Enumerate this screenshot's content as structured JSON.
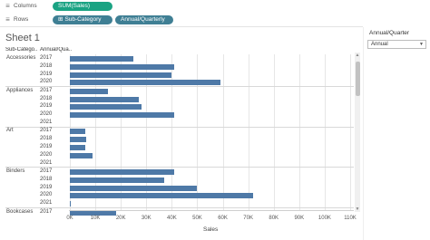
{
  "shelves": {
    "columns": {
      "label": "Columns",
      "icon": "columns-icon",
      "pills": [
        {
          "text": "SUM(Sales)",
          "color": "#1aa383"
        }
      ]
    },
    "rows": {
      "label": "Rows",
      "icon": "rows-icon",
      "pills": [
        {
          "text": "Sub-Category",
          "color": "#3f7f94"
        },
        {
          "text": "Annual/Quarterly",
          "color": "#3f7f94"
        }
      ]
    }
  },
  "sheet": {
    "title": "Sheet 1",
    "header_subcategory": "Sub-Catego..",
    "header_year": "Annual/Qua.."
  },
  "chart_data": {
    "type": "bar",
    "orientation": "horizontal",
    "xlabel": "Sales",
    "xlim": [
      0,
      110000
    ],
    "x_ticks": [
      "0K",
      "10K",
      "20K",
      "30K",
      "40K",
      "50K",
      "60K",
      "70K",
      "80K",
      "90K",
      "100K",
      "110K"
    ],
    "groups": [
      {
        "category": "Accessories",
        "rows": [
          {
            "year": "2017",
            "value": 25000
          },
          {
            "year": "2018",
            "value": 41000
          },
          {
            "year": "2019",
            "value": 40000
          },
          {
            "year": "2020",
            "value": 59000
          }
        ]
      },
      {
        "category": "Appliances",
        "rows": [
          {
            "year": "2017",
            "value": 15000
          },
          {
            "year": "2018",
            "value": 27000
          },
          {
            "year": "2019",
            "value": 28000
          },
          {
            "year": "2020",
            "value": 41000
          },
          {
            "year": "2021",
            "value": null
          }
        ]
      },
      {
        "category": "Art",
        "rows": [
          {
            "year": "2017",
            "value": 6000
          },
          {
            "year": "2018",
            "value": 6500
          },
          {
            "year": "2019",
            "value": 6000
          },
          {
            "year": "2020",
            "value": 9000
          },
          {
            "year": "2021",
            "value": null
          }
        ]
      },
      {
        "category": "Binders",
        "rows": [
          {
            "year": "2017",
            "value": 41000
          },
          {
            "year": "2018",
            "value": 37000
          },
          {
            "year": "2019",
            "value": 50000
          },
          {
            "year": "2020",
            "value": 72000
          },
          {
            "year": "2021",
            "value": 500
          }
        ]
      },
      {
        "category": "Bookcases",
        "rows": [
          {
            "year": "2017",
            "value": 18000
          }
        ]
      }
    ]
  },
  "right_panel": {
    "filter_title": "Annual/Quarter",
    "filter_value": "Annual"
  },
  "colors": {
    "bar": "#4e79a7",
    "measure_pill": "#1aa383",
    "dimension_pill": "#3f7f94"
  }
}
